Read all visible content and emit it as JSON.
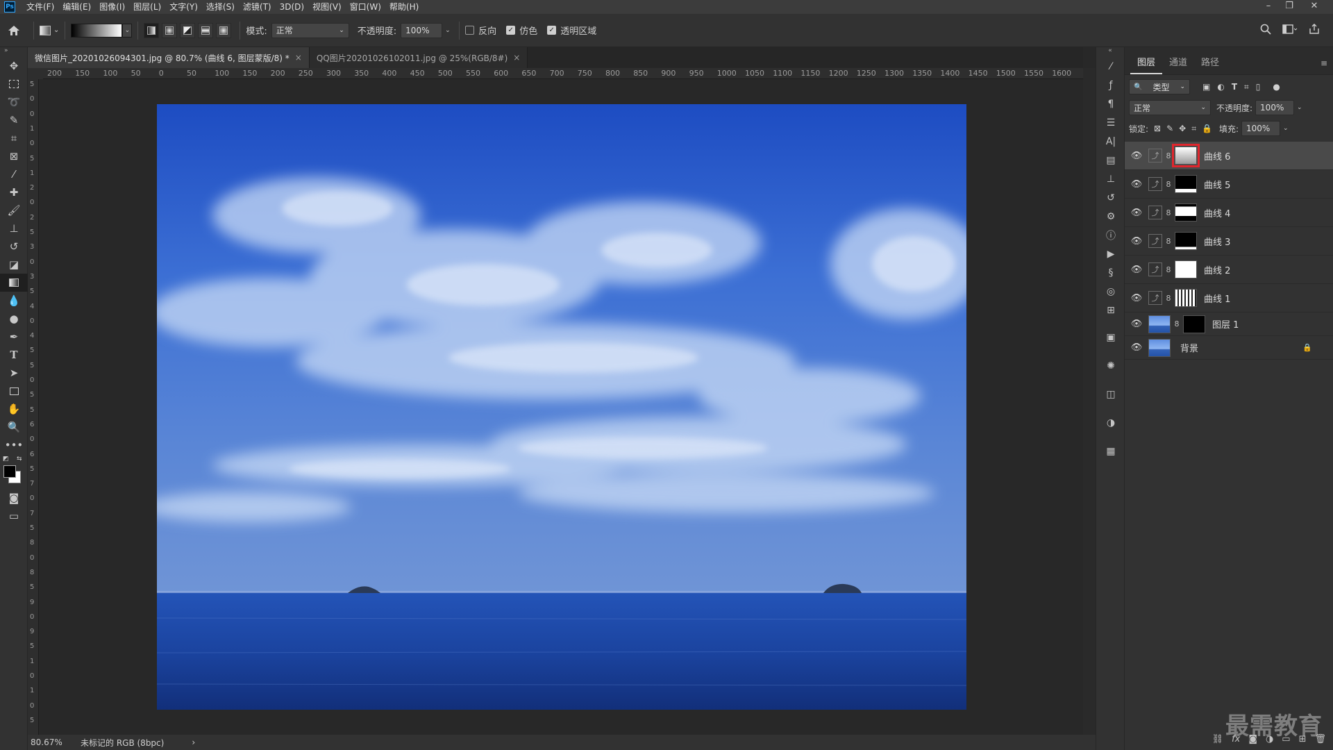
{
  "menu": {
    "logo": "Ps",
    "items": [
      "文件(F)",
      "编辑(E)",
      "图像(I)",
      "图层(L)",
      "文字(Y)",
      "选择(S)",
      "滤镜(T)",
      "3D(D)",
      "视图(V)",
      "窗口(W)",
      "帮助(H)"
    ],
    "win_minimize": "–",
    "win_restore": "❐",
    "win_close": "✕"
  },
  "options": {
    "mode_label": "模式:",
    "mode_value": "正常",
    "opacity_label": "不透明度:",
    "opacity_value": "100%",
    "reverse_label": "反向",
    "reverse_checked": false,
    "dither_label": "仿色",
    "dither_checked": true,
    "transparency_label": "透明区域",
    "transparency_checked": true
  },
  "tabs": [
    {
      "label": "微信图片_20201026094301.jpg @ 80.7% (曲线 6, 图层蒙版/8) *",
      "close": "×"
    },
    {
      "label": "QQ图片20201026102011.jpg @ 25%(RGB/8#)",
      "close": "×"
    }
  ],
  "ruler": {
    "top": [
      "200",
      "150",
      "100",
      "50",
      "0",
      "50",
      "100",
      "150",
      "200",
      "250",
      "300",
      "350",
      "400",
      "450",
      "500",
      "550",
      "600",
      "650",
      "700",
      "750",
      "800",
      "850",
      "900",
      "950",
      "1000",
      "1050",
      "1100",
      "1150",
      "1200",
      "1250",
      "1300",
      "1350",
      "1400",
      "1450",
      "1500",
      "1550",
      "1600"
    ],
    "left": [
      "5",
      "0",
      "0",
      "1",
      "0",
      "5",
      "1",
      "2",
      "0",
      "2",
      "5",
      "3",
      "0",
      "3",
      "5",
      "4",
      "0",
      "4",
      "5",
      "5",
      "0",
      "5",
      "5",
      "6",
      "0",
      "6",
      "5",
      "7",
      "0",
      "7",
      "5",
      "8",
      "0",
      "8",
      "5",
      "9",
      "0",
      "9",
      "5",
      "1",
      "0",
      "1",
      "0",
      "5"
    ]
  },
  "status": {
    "zoom": "80.67%",
    "info": "未标记的 RGB (8bpc)",
    "arrow": "›"
  },
  "layers_panel": {
    "tabs": [
      "图层",
      "通道",
      "路径"
    ],
    "filter_label": "类型",
    "blend_mode": "正常",
    "opacity_label": "不透明度:",
    "opacity_value": "100%",
    "lock_label": "锁定:",
    "fill_label": "填充:",
    "fill_value": "100%",
    "layers": [
      {
        "name": "曲线 6",
        "kind": "curves",
        "selected": true
      },
      {
        "name": "曲线 5",
        "kind": "curves",
        "selected": false
      },
      {
        "name": "曲线 4",
        "kind": "curves",
        "selected": false
      },
      {
        "name": "曲线 3",
        "kind": "curves",
        "selected": false
      },
      {
        "name": "曲线 2",
        "kind": "curves",
        "selected": false
      },
      {
        "name": "曲线 1",
        "kind": "curves",
        "selected": false
      },
      {
        "name": "图层 1",
        "kind": "pixel",
        "selected": false
      },
      {
        "name": "背景",
        "kind": "background",
        "selected": false
      }
    ]
  },
  "watermark": "最需教育",
  "colors": {
    "accent_red": "#e0262d",
    "panel_bg": "#323232",
    "canvas_bg": "#282828"
  }
}
